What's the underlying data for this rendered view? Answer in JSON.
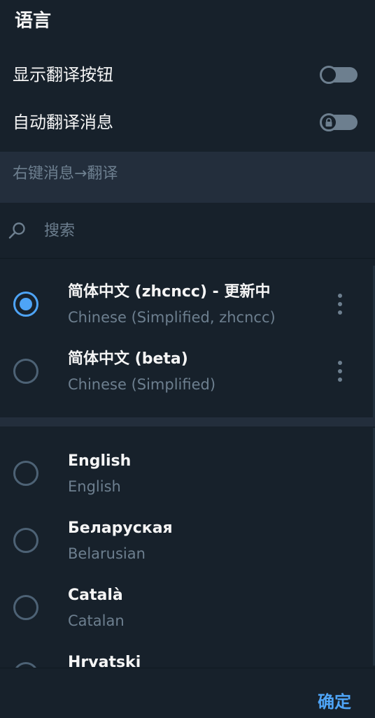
{
  "header": {
    "title": "语言"
  },
  "settings": {
    "show_translate_button": {
      "label": "显示翻译按钮",
      "enabled": false
    },
    "auto_translate": {
      "label": "自动翻译消息",
      "enabled": false,
      "locked": true
    }
  },
  "hint": {
    "text": "右键消息→翻译"
  },
  "search": {
    "placeholder": "搜索",
    "value": ""
  },
  "installed_languages": [
    {
      "name": "简体中文 (zhcncc) - 更新中",
      "native": "Chinese (Simplified, zhcncc)",
      "selected": true
    },
    {
      "name": "简体中文 (beta)",
      "native": "Chinese (Simplified)",
      "selected": false
    }
  ],
  "languages": [
    {
      "name": "English",
      "native": "English",
      "selected": false
    },
    {
      "name": "Беларуская",
      "native": "Belarusian",
      "selected": false
    },
    {
      "name": "Català",
      "native": "Catalan",
      "selected": false
    },
    {
      "name": "Hrvatski",
      "native": "",
      "selected": false
    }
  ],
  "footer": {
    "confirm_label": "确定"
  },
  "colors": {
    "background": "#17212b",
    "section_background": "#232e3c",
    "accent": "#4ea4f6",
    "secondary_text": "#6d7f8f",
    "primary_text": "#f5f5f5"
  },
  "icons": {
    "search": "search-icon",
    "lock": "lock-icon",
    "more": "more-vertical-icon"
  }
}
